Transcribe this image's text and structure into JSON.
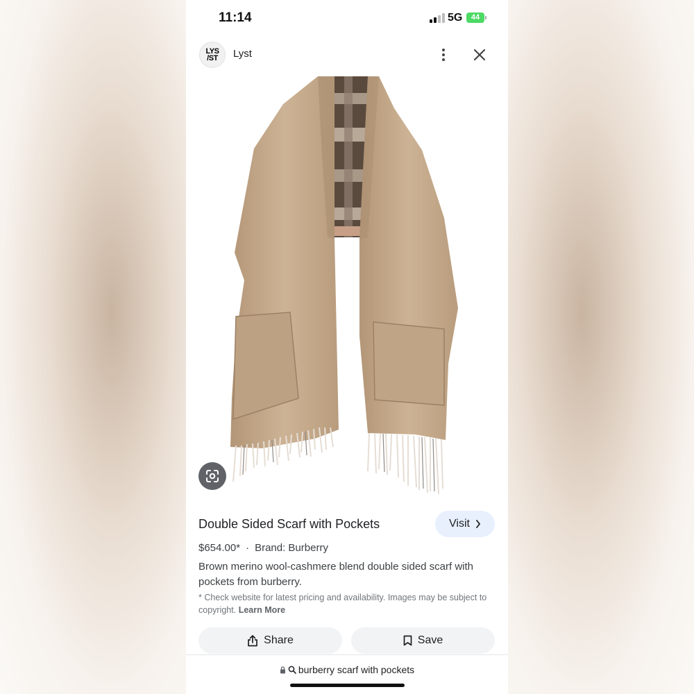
{
  "status_bar": {
    "time": "11:14",
    "network": "5G",
    "battery": "44"
  },
  "source": {
    "logo_text_top": "LYS",
    "logo_text_bottom": "/ST",
    "name": "Lyst"
  },
  "product": {
    "title": "Double Sided Scarf with Pockets",
    "visit_label": "Visit",
    "price": "$654.00*",
    "separator": "·",
    "brand": "Brand: Burberry",
    "description": "Brown merino wool-cashmere blend double sided scarf with pockets from burberry.",
    "disclaimer": "* Check website for latest pricing and availability. Images may be subject to copyright.",
    "learn_more": "Learn More"
  },
  "actions": {
    "share_label": "Share",
    "save_label": "Save"
  },
  "browser": {
    "url_text": "burberry scarf with pockets"
  },
  "colors": {
    "accent_bg": "#e8f0fe",
    "battery": "#4cd964",
    "scarf": "#c4a88a"
  },
  "icons": [
    "signal-icon",
    "battery-icon",
    "more-vert-icon",
    "close-icon",
    "lens-icon",
    "chevron-right-icon",
    "share-icon",
    "bookmark-icon",
    "lock-icon",
    "search-icon"
  ]
}
